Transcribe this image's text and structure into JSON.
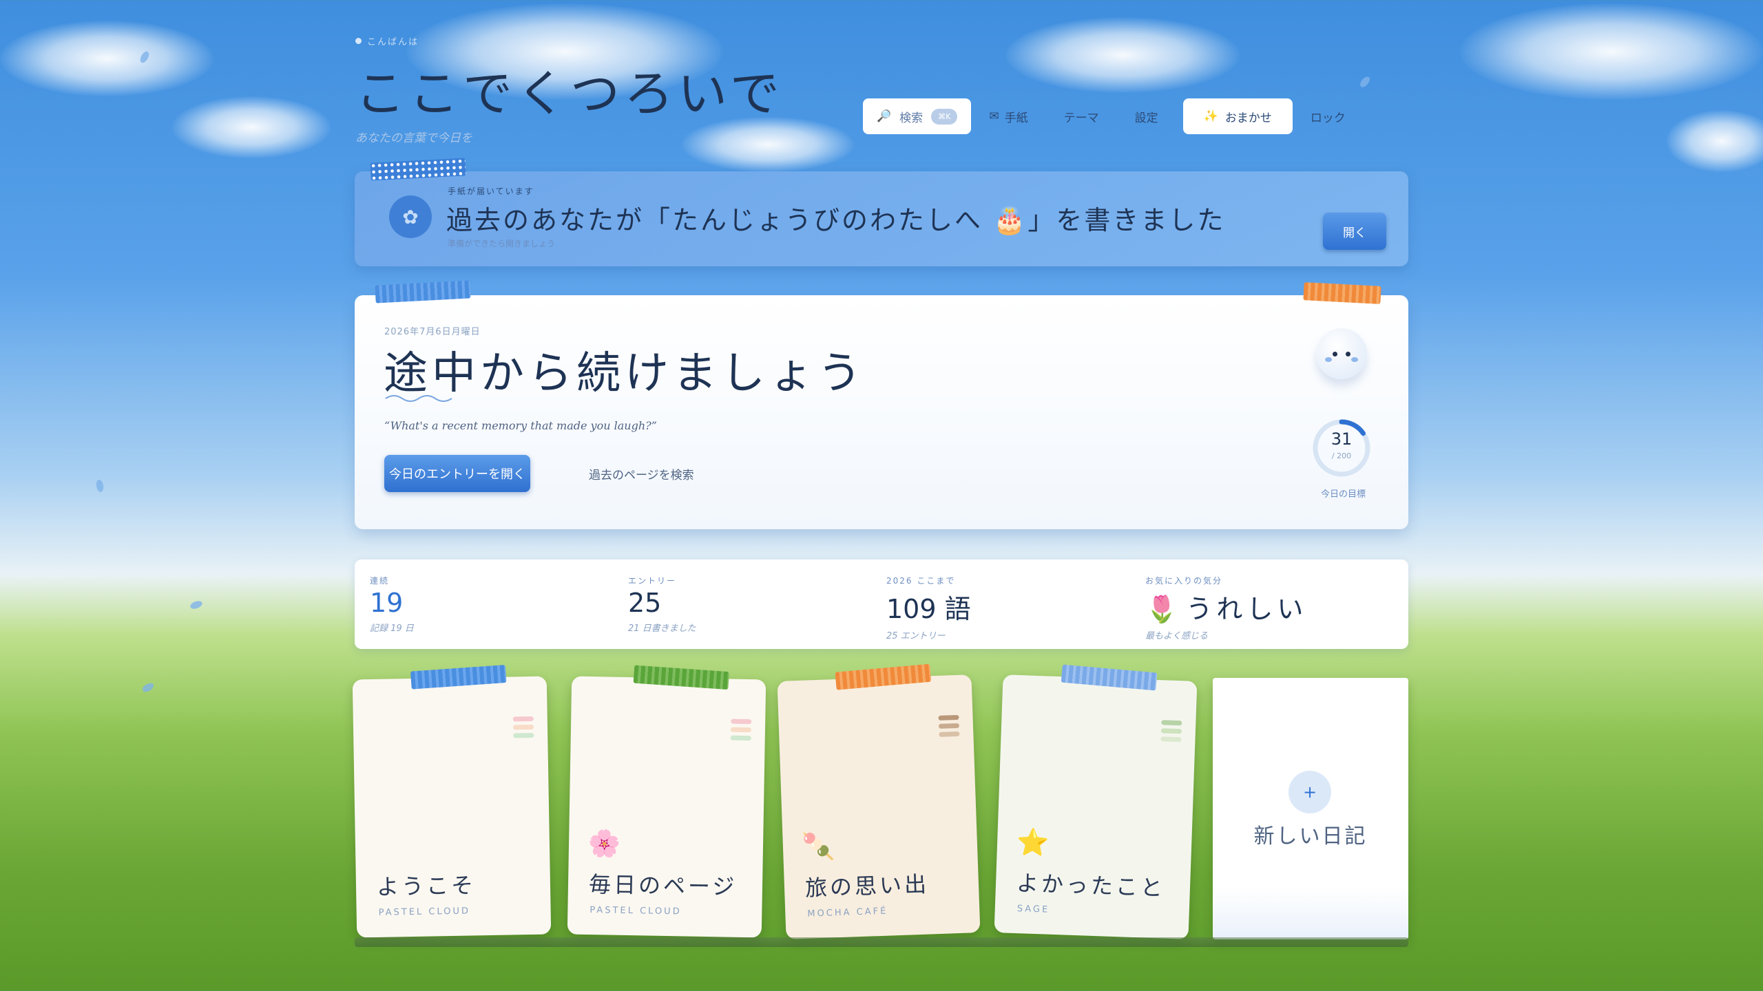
{
  "header": {
    "greeting": "こんばんは",
    "title": "ここでくつろいで",
    "subtitle": "あなたの言葉で今日を"
  },
  "nav": {
    "search_label": "検索",
    "search_shortcut": "⌘K",
    "letter_label": "手紙",
    "theme_label": "テーマ",
    "settings_label": "設定",
    "omakase_label": "おまかせ",
    "lock_label": "ロック"
  },
  "banner": {
    "small": "手紙が届いています",
    "main": "過去のあなたが「たんじょうびのわたしへ 🎂」を書きました",
    "sub": "準備ができたら開きましょう",
    "open_label": "開く"
  },
  "hero": {
    "date": "2026年7月6日月曜日",
    "heading": "途中から続けましょう",
    "quote": "“What's a recent memory that made you laugh?”",
    "open_button": "今日のエントリーを開く",
    "search_link": "過去のページを検索",
    "goal_current": "31",
    "goal_total": "/ 200",
    "goal_progress": 0.155,
    "goal_label": "今日の目標"
  },
  "stats": [
    {
      "label": "連続",
      "value": "19",
      "note": "記録 19 日"
    },
    {
      "label": "エントリー",
      "value": "25",
      "note": "21 日書きました"
    },
    {
      "label": "2026 ここまで",
      "value": "109 語",
      "note": "25 エントリー"
    },
    {
      "label": "お気に入りの気分",
      "value": "うれしい",
      "icon": "🌷",
      "note": "最もよく感じる"
    }
  ],
  "journals": [
    {
      "title": "ようこそ",
      "theme": "PASTEL CLOUD",
      "icon": "",
      "bg": "#fbf8f1"
    },
    {
      "title": "毎日のページ",
      "theme": "PASTEL CLOUD",
      "icon": "🌸",
      "bg": "#fbf8f1"
    },
    {
      "title": "旅の思い出",
      "theme": "MOCHA CAFÉ",
      "icon": "🍡",
      "bg": "#f8eedf"
    },
    {
      "title": "よかったこと",
      "theme": "SAGE",
      "icon": "⭐",
      "bg": "#f4f6ee"
    }
  ],
  "new_journal": {
    "plus": "+",
    "label": "新しい日記"
  },
  "colors": {
    "accent": "#2f72d2",
    "text": "#1e3354"
  }
}
